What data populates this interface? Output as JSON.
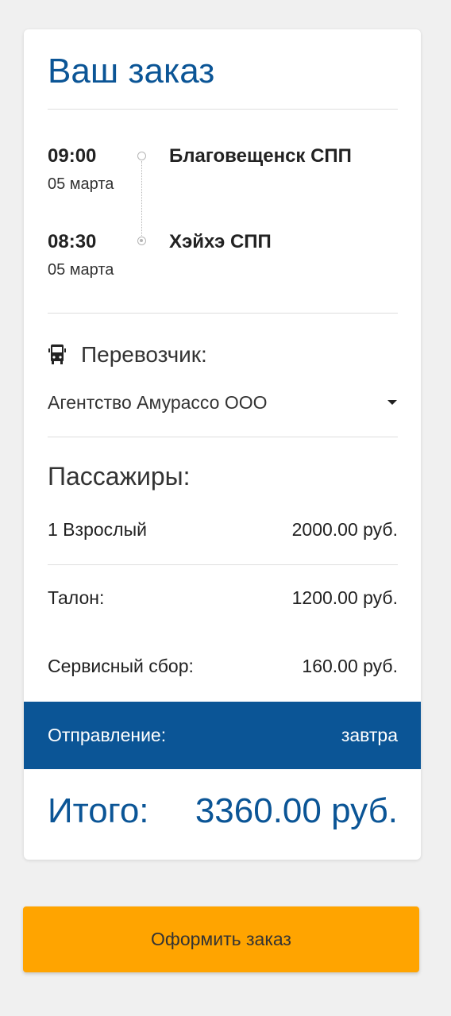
{
  "order": {
    "title": "Ваш заказ",
    "route": {
      "departure": {
        "time": "09:00",
        "date": "05 марта",
        "station": "Благовещенск СПП"
      },
      "arrival": {
        "time": "08:30",
        "date": "05 марта",
        "station": "Хэйхэ СПП"
      }
    },
    "carrier": {
      "label": "Перевозчик:",
      "icon": "bus-icon",
      "selected": "Агентство Амурассо ООО"
    },
    "passengers": {
      "title": "Пассажиры:",
      "items": [
        {
          "label": "1 Взрослый",
          "price": "2000.00 руб."
        }
      ]
    },
    "fees": [
      {
        "label": "Талон:",
        "price": "1200.00 руб."
      },
      {
        "label": "Сервисный сбор:",
        "price": "160.00 руб."
      }
    ],
    "departure_info": {
      "label": "Отправление:",
      "value": "завтра"
    },
    "total": {
      "label": "Итого:",
      "value": "3360.00 руб."
    }
  },
  "actions": {
    "submit_label": "Оформить заказ"
  },
  "colors": {
    "accent_blue": "#0b5596",
    "button_orange": "#ffa400",
    "background": "#f0f0f0"
  }
}
